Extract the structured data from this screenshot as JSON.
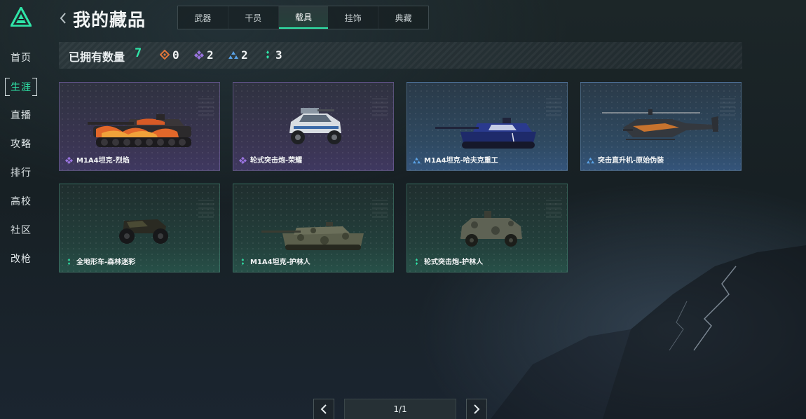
{
  "sidebar": {
    "items": [
      {
        "label": "首页"
      },
      {
        "label": "生涯"
      },
      {
        "label": "直播"
      },
      {
        "label": "攻略"
      },
      {
        "label": "排行"
      },
      {
        "label": "高校"
      },
      {
        "label": "社区"
      },
      {
        "label": "改枪"
      }
    ],
    "active_index": 1
  },
  "header": {
    "title": "我的藏品",
    "tabs": [
      {
        "label": "武器"
      },
      {
        "label": "干员"
      },
      {
        "label": "载具"
      },
      {
        "label": "挂饰"
      },
      {
        "label": "典藏"
      }
    ],
    "active_tab_index": 2
  },
  "stats": {
    "owned_label": "已拥有数量",
    "owned_count": "7",
    "rarities": [
      {
        "icon": "orange-diamond-icon",
        "color": "#e0763a",
        "count": "0"
      },
      {
        "icon": "purple-diamond-icon",
        "color": "#9a74e0",
        "count": "2"
      },
      {
        "icon": "blue-triangle-icon",
        "color": "#5aa2e6",
        "count": "2"
      },
      {
        "icon": "green-dots-icon",
        "color": "#2fe5a8",
        "count": "3"
      }
    ]
  },
  "collection": {
    "items": [
      {
        "name": "M1A4坦克-烈焰",
        "rarity": "purple",
        "vehicle": "tank-flame"
      },
      {
        "name": "轮式突击炮-荣耀",
        "rarity": "purple",
        "vehicle": "buggy-white"
      },
      {
        "name": "M1A4坦克-哈夫克重工",
        "rarity": "blue",
        "vehicle": "tank-blue"
      },
      {
        "name": "突击直升机-原始伪装",
        "rarity": "blue",
        "vehicle": "helicopter"
      },
      {
        "name": "全地形车-森林迷彩",
        "rarity": "green",
        "vehicle": "atv"
      },
      {
        "name": "M1A4坦克-护林人",
        "rarity": "green",
        "vehicle": "tank-camo"
      },
      {
        "name": "轮式突击炮-护林人",
        "rarity": "green",
        "vehicle": "armored-car"
      }
    ]
  },
  "pagination": {
    "label": "1/1",
    "prev_icon": "chevron-left-icon",
    "next_icon": "chevron-right-icon"
  },
  "colors": {
    "accent": "#2fe5a8",
    "purple": "#9a74e0",
    "blue": "#5aa2e6",
    "green": "#2fe5a8",
    "orange": "#e0763a"
  }
}
